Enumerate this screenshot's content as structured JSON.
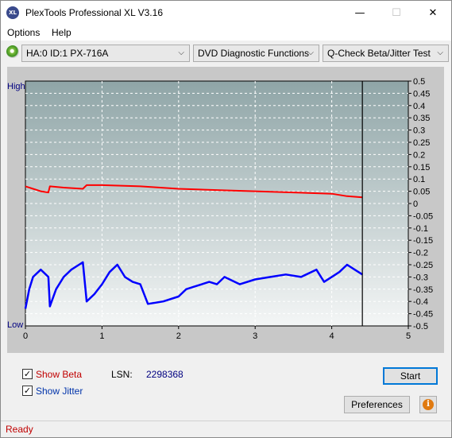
{
  "window": {
    "title": "PlexTools Professional XL V3.16",
    "icon_label": "XL",
    "minimize_icon": "—",
    "maximize_icon": "☐",
    "close_icon": "✕"
  },
  "menu": {
    "options": "Options",
    "help": "Help"
  },
  "toolbar": {
    "drive": "HA:0 ID:1  PX-716A",
    "function": "DVD Diagnostic Functions",
    "test": "Q-Check Beta/Jitter Test",
    "chevron": "⌵"
  },
  "chart_data": {
    "type": "line",
    "left_axis_labels": {
      "high": "High",
      "low": "Low"
    },
    "x_ticks": [
      "0",
      "1",
      "2",
      "3",
      "4",
      "5"
    ],
    "xlim": [
      0,
      5
    ],
    "y_ticks": [
      "0.5",
      "0.45",
      "0.4",
      "0.35",
      "0.3",
      "0.25",
      "0.2",
      "0.15",
      "0.1",
      "0.05",
      "0",
      "-0.05",
      "-0.1",
      "-0.15",
      "-0.2",
      "-0.25",
      "-0.3",
      "-0.35",
      "-0.4",
      "-0.45",
      "-0.5"
    ],
    "ylim": [
      -0.5,
      0.5
    ],
    "end_marker_x": 4.4,
    "grid": true,
    "series": [
      {
        "color": "#ff0000",
        "x": [
          0,
          0.1,
          0.2,
          0.3,
          0.32,
          0.5,
          0.75,
          0.8,
          1.0,
          1.5,
          2.0,
          2.5,
          3.0,
          3.5,
          4.0,
          4.2,
          4.4
        ],
        "y": [
          0.07,
          0.06,
          0.05,
          0.045,
          0.07,
          0.065,
          0.06,
          0.075,
          0.075,
          0.07,
          0.06,
          0.055,
          0.05,
          0.045,
          0.04,
          0.03,
          0.025
        ]
      },
      {
        "color": "#0000ff",
        "x": [
          0,
          0.05,
          0.1,
          0.2,
          0.3,
          0.32,
          0.4,
          0.5,
          0.6,
          0.7,
          0.75,
          0.8,
          0.9,
          1.0,
          1.1,
          1.2,
          1.3,
          1.4,
          1.5,
          1.6,
          1.8,
          2.0,
          2.1,
          2.2,
          2.4,
          2.5,
          2.6,
          2.8,
          3.0,
          3.2,
          3.4,
          3.6,
          3.8,
          3.9,
          4.0,
          4.1,
          4.2,
          4.3,
          4.4
        ],
        "y": [
          -0.43,
          -0.35,
          -0.3,
          -0.27,
          -0.3,
          -0.42,
          -0.35,
          -0.3,
          -0.27,
          -0.25,
          -0.24,
          -0.4,
          -0.37,
          -0.33,
          -0.28,
          -0.25,
          -0.3,
          -0.32,
          -0.33,
          -0.41,
          -0.4,
          -0.38,
          -0.35,
          -0.34,
          -0.32,
          -0.33,
          -0.3,
          -0.33,
          -0.31,
          -0.3,
          -0.29,
          -0.3,
          -0.27,
          -0.32,
          -0.3,
          -0.28,
          -0.25,
          -0.27,
          -0.29
        ]
      }
    ]
  },
  "bottom": {
    "show_beta_label": "Show Beta",
    "show_jitter_label": "Show Jitter",
    "check_mark": "✓",
    "lsn_label": "LSN:",
    "lsn_value": "2298368",
    "start_button": "Start",
    "preferences_button": "Preferences",
    "info_icon": "i"
  },
  "status": {
    "text": "Ready"
  },
  "colors": {
    "beta_label": "#c00000",
    "jitter_label": "#0033aa",
    "lsn_value": "#000080",
    "axis_text": "#000080"
  }
}
